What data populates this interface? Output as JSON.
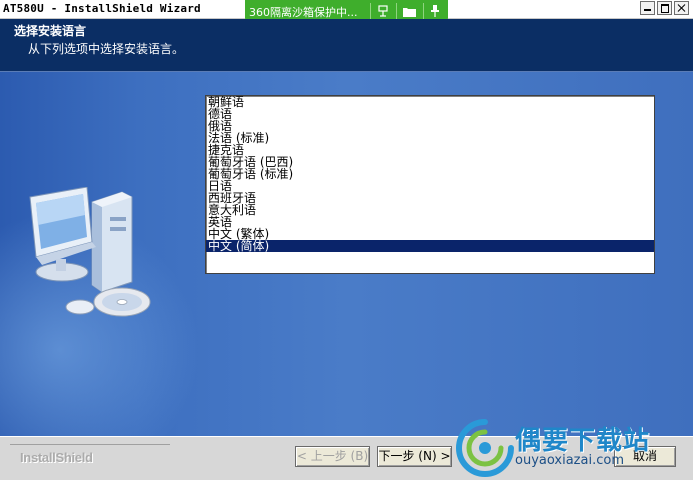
{
  "window": {
    "title": "AT580U - InstallShield Wizard"
  },
  "sandbox_bar": {
    "text": "360隔离沙箱保护中...",
    "icons": [
      "network-icon",
      "folder-icon",
      "pin-icon"
    ],
    "color": "#3fae2c"
  },
  "header": {
    "title": "选择安装语言",
    "subtitle": "从下列选项中选择安装语言。"
  },
  "language_list": {
    "items": [
      {
        "label": "朝鲜语",
        "selected": false
      },
      {
        "label": "德语",
        "selected": false
      },
      {
        "label": "俄语",
        "selected": false
      },
      {
        "label": "法语 (标准)",
        "selected": false
      },
      {
        "label": "捷克语",
        "selected": false
      },
      {
        "label": "葡萄牙语 (巴西)",
        "selected": false
      },
      {
        "label": "葡萄牙语 (标准)",
        "selected": false
      },
      {
        "label": "日语",
        "selected": false
      },
      {
        "label": "西班牙语",
        "selected": false
      },
      {
        "label": "意大利语",
        "selected": false
      },
      {
        "label": "英语",
        "selected": false
      },
      {
        "label": "中文 (繁体)",
        "selected": false
      },
      {
        "label": "中文 (简体)",
        "selected": true
      }
    ],
    "selection_color": "#0a246a"
  },
  "footer": {
    "brand": "InstallShield",
    "back_label": "< 上一步 (B)",
    "next_label": "下一步 (N) >",
    "cancel_label": "取消"
  },
  "watermark": {
    "title": "偶要下载站",
    "url": "ouyaoxiazai.com"
  }
}
